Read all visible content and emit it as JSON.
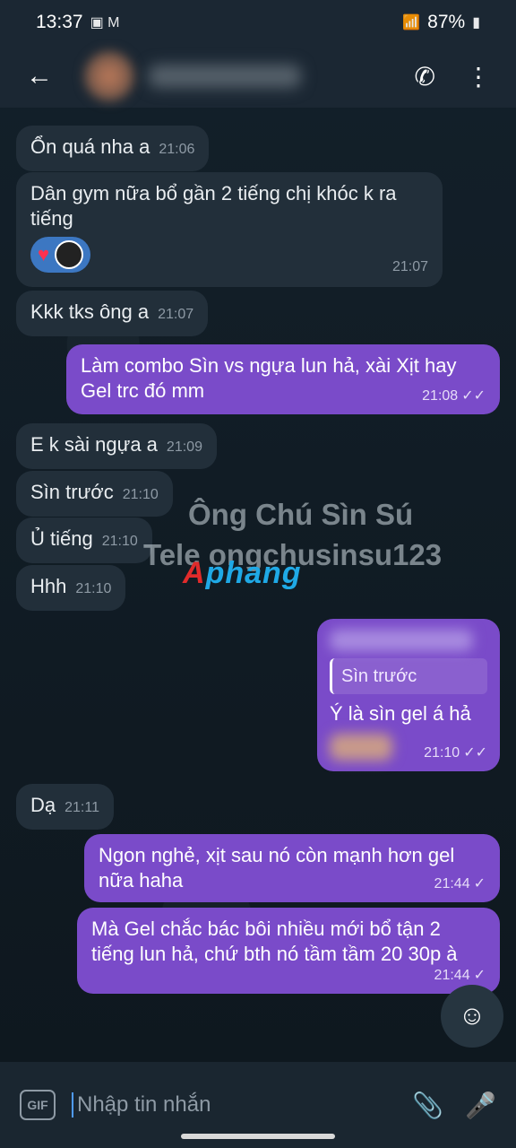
{
  "status_bar": {
    "time": "13:37",
    "battery": "87%"
  },
  "header": {
    "back_icon": "back-arrow-icon",
    "call_icon": "phone-icon",
    "menu_icon": "more-vert-icon"
  },
  "messages": [
    {
      "text": "Ổn quá nha a",
      "time": "21:06",
      "side": "in"
    },
    {
      "text": "Dân gym nữa bổ gần 2 tiếng chị khóc k ra tiếng",
      "time": "21:07",
      "side": "in"
    },
    {
      "text": "Kkk tks ông a",
      "time": "21:07",
      "side": "in"
    },
    {
      "text": "Làm combo Sìn vs ngựa lun hả, xài Xịt hay Gel trc đó mm",
      "time": "21:08",
      "side": "out"
    },
    {
      "text": "E k sài ngựa a",
      "time": "21:09",
      "side": "in"
    },
    {
      "text": "Sìn trước",
      "time": "21:10",
      "side": "in"
    },
    {
      "text": "Ủ tiếng",
      "time": "21:10",
      "side": "in"
    },
    {
      "text": "Hhh",
      "time": "21:10",
      "side": "in"
    },
    {
      "reply": "Sìn trước",
      "text": "Ý là sìn gel á hả",
      "time": "21:10",
      "side": "out"
    },
    {
      "text": "Dạ",
      "time": "21:11",
      "side": "in"
    },
    {
      "text": "Ngon nghẻ, xịt sau nó còn mạnh hơn gel nữa haha",
      "time": "21:44",
      "side": "out"
    },
    {
      "text": "Mà Gel chắc bác bôi nhiều mới bổ tận 2 tiếng lun hả, chứ bth nó tầm tầm 20 30p à",
      "time": "21:44",
      "side": "out"
    }
  ],
  "watermark": {
    "line1": "Ông Chú Sìn Sú",
    "line2": "Tele ongchusinsu123",
    "logo_a": "A",
    "logo_rest": "phang"
  },
  "input": {
    "placeholder": "Nhập tin nhắn",
    "gif_label": "GIF"
  },
  "colors": {
    "incoming_bubble": "#222f3a",
    "outgoing_bubble": "#7a4bc9",
    "background": "#0f1a22"
  }
}
